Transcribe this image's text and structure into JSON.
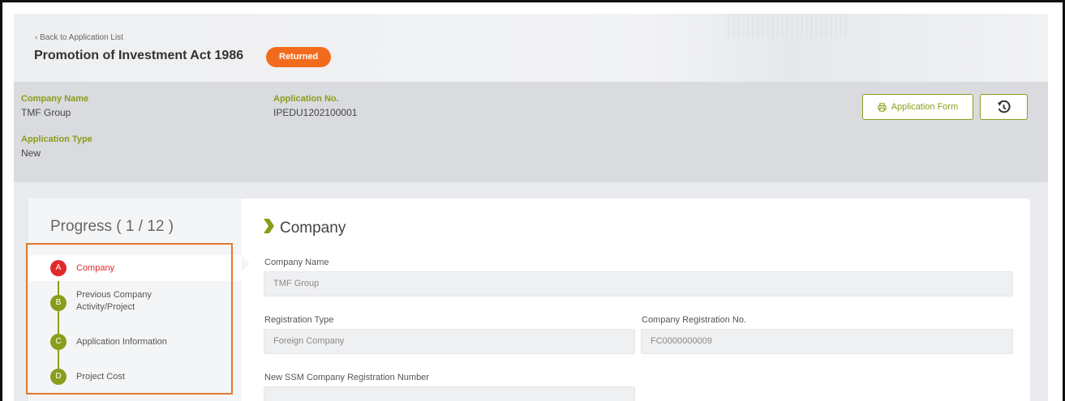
{
  "header": {
    "back_link": "‹ Back to Application List",
    "title": "Promotion of Investment Act 1986",
    "status": "Returned"
  },
  "info": {
    "company_name_label": "Company Name",
    "company_name": "TMF Group",
    "application_no_label": "Application No.",
    "application_no": "IPEDU1202100001",
    "application_type_label": "Application Type",
    "application_type": "New",
    "application_form_button": "Application Form",
    "history_icon": "history-icon",
    "print_icon": "print-icon"
  },
  "progress": {
    "title": "Progress ( 1 / 12 )",
    "steps": [
      {
        "letter": "A",
        "label": "Company",
        "active": true
      },
      {
        "letter": "B",
        "label": "Previous Company Activity/Project",
        "active": false
      },
      {
        "letter": "C",
        "label": "Application Information",
        "active": false
      },
      {
        "letter": "D",
        "label": "Project Cost",
        "active": false
      }
    ]
  },
  "form": {
    "section_title": "Company",
    "company_name_label": "Company Name",
    "company_name_value": "TMF Group",
    "registration_type_label": "Registration Type",
    "registration_type_value": "Foreign Company",
    "company_reg_no_label": "Company Registration No.",
    "company_reg_no_value": "FC0000000009",
    "new_ssm_label": "New SSM Company Registration Number"
  },
  "colors": {
    "accent": "#8a9d1b",
    "status": "#f26b1d",
    "active_step": "#e02a2a",
    "highlight": "#e07a2e"
  }
}
